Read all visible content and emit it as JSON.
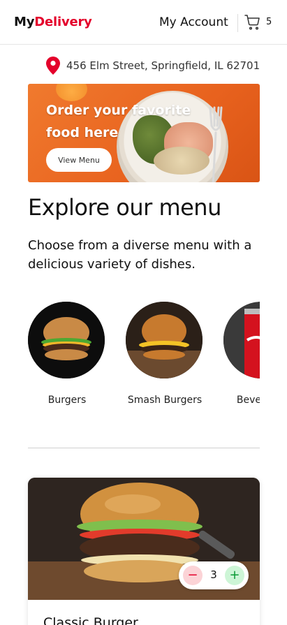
{
  "header": {
    "brand_prefix": "My",
    "brand_name": "Delivery",
    "account_label": "My Account",
    "cart_icon": "cart-icon",
    "cart_count": "5"
  },
  "address": {
    "icon": "location-pin-icon",
    "text": "456 Elm Street, Springfield, IL 62701"
  },
  "banner": {
    "title": "Order your favorite food here",
    "button_label": "View Menu"
  },
  "menu_section": {
    "title": "Explore our menu",
    "description": "Choose from a diverse menu with a delicious variety of dishes."
  },
  "categories": [
    {
      "label": "Burgers"
    },
    {
      "label": "Smash Burgers"
    },
    {
      "label": "Beverages"
    }
  ],
  "product": {
    "name": "Classic Burger",
    "quantity": "3",
    "minus_label": "−",
    "plus_label": "+"
  },
  "colors": {
    "brand_red": "#e4002b",
    "banner_orange": "#f07a2e",
    "minus_bg": "#fbd3d6",
    "plus_bg": "#cdf5d6"
  }
}
